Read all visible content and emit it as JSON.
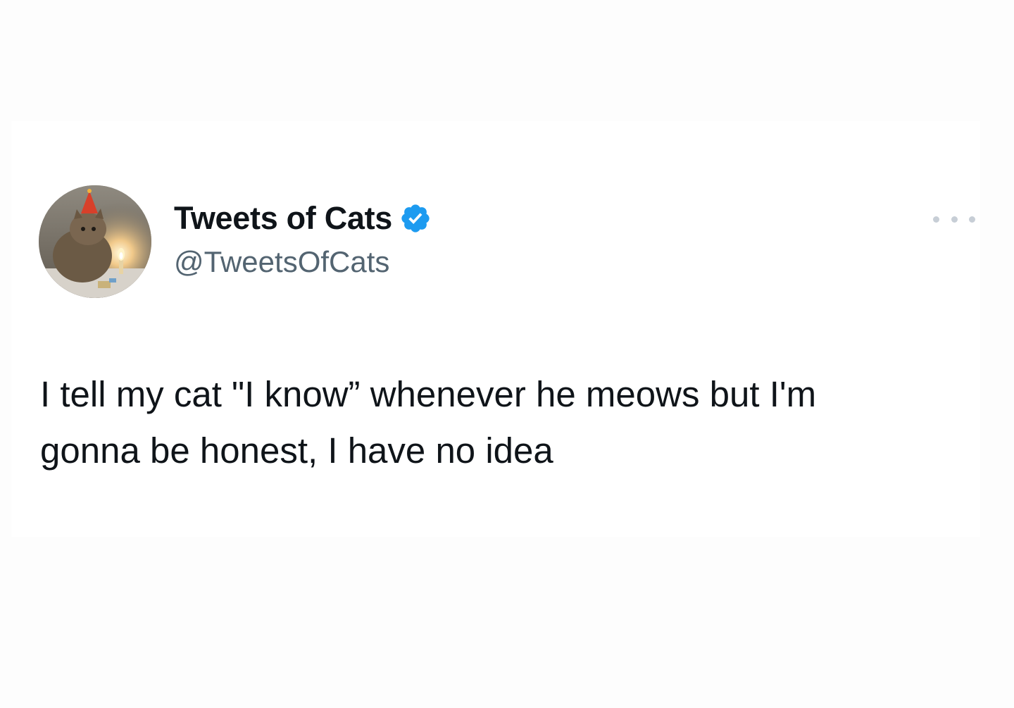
{
  "author": {
    "display_name": "Tweets of Cats",
    "handle": "@TweetsOfCats",
    "verified_icon": "verified-badge-icon",
    "avatar": "cat-with-party-hat-and-candle"
  },
  "menu": {
    "icon": "more-options-icon"
  },
  "tweet": {
    "text": "I tell my cat \"I know” whenever he meows but I'm\ngonna be honest, I have no idea"
  },
  "colors": {
    "verified_blue": "#1d9bf0",
    "name": "#0f1419",
    "handle": "#536471",
    "background": "#ffffff"
  }
}
